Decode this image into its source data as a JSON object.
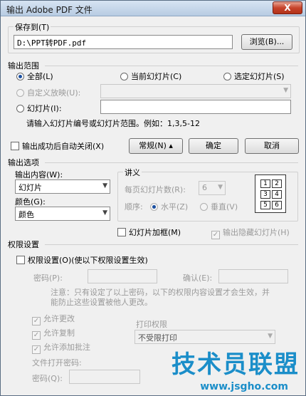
{
  "window": {
    "title": "输出 Adobe PDF 文件",
    "close_glyph": "X"
  },
  "save": {
    "legend": "保存到(T)",
    "path": "D:\\PPT转PDF.pdf",
    "browse": "浏览(B)..."
  },
  "range": {
    "legend": "输出范围",
    "all": "全部(L)",
    "current": "当前幻灯片(C)",
    "selected": "选定幻灯片(S)",
    "custom": "自定义放映(U):",
    "slides": "幻灯片(I):",
    "hint": "请输入幻灯片编号或幻灯片范围。例如：1,3,5-12"
  },
  "auto_close": "输出成功后自动关闭(X)",
  "buttons": {
    "normal": "常规(N) ▴",
    "ok": "确定",
    "cancel": "取消"
  },
  "options": {
    "legend": "输出选项",
    "content_label": "输出内容(W):",
    "content_value": "幻灯片",
    "color_label": "颜色(G):",
    "color_value": "颜色",
    "handout_legend": "讲义",
    "per_page_label": "每页幻灯片数(R):",
    "per_page_value": "6",
    "order_label": "顺序:",
    "horizontal": "水平(Z)",
    "vertical": "垂直(V)",
    "frame": "幻灯片加框(M)",
    "hidden": "输出隐藏幻灯片(H)",
    "grid": [
      "1",
      "2",
      "3",
      "4",
      "5",
      "6"
    ]
  },
  "security": {
    "legend": "权限设置",
    "toggle": "权限设置(O)(使以下权限设置生效)",
    "password_label": "密码(P):",
    "confirm_label": "确认(E):",
    "note_line1": "注意：只有设定了以上密码，以下的权限内容设置才会生效，并",
    "note_line2": "能防止这些设置被他人更改。",
    "allow_edit": "允许更改",
    "allow_copy": "允许复制",
    "allow_comment": "允许添加批注",
    "print_label": "打印权限",
    "print_value": "不受限打印",
    "open_pw_title": "文件打开密码:",
    "open_pw_label": "密码(Q):"
  },
  "watermark": {
    "text": "技术员联盟",
    "url": "www.jsgho.com"
  }
}
